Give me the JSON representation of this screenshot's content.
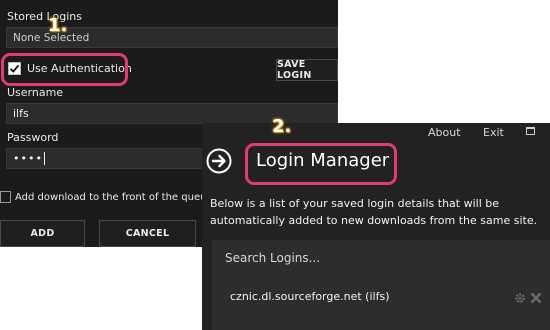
{
  "back": {
    "stored_logins_label": "Stored Logins",
    "stored_logins_value": "None Selected",
    "use_auth_label": "Use Authentication",
    "use_auth_checked": true,
    "save_login_label": "SAVE LOGIN",
    "username_label": "Username",
    "username_value": "ilfs",
    "password_label": "Password",
    "password_value": "••••",
    "queue_label": "Add download to the front of the queue",
    "add_label": "ADD",
    "cancel_label": "CANCEL"
  },
  "front": {
    "about_label": "About",
    "exit_label": "Exit",
    "title": "Login Manager",
    "description": "Below is a list of your saved login details that will be automatically added to new downloads from the same site.",
    "search_placeholder": "Search Logins...",
    "logins": [
      {
        "text": "cznic.dl.sourceforge.net (ilfs)"
      }
    ]
  },
  "annotations": {
    "step1": "1.",
    "step2": "2.",
    "ring_color": "#e23b6e"
  }
}
